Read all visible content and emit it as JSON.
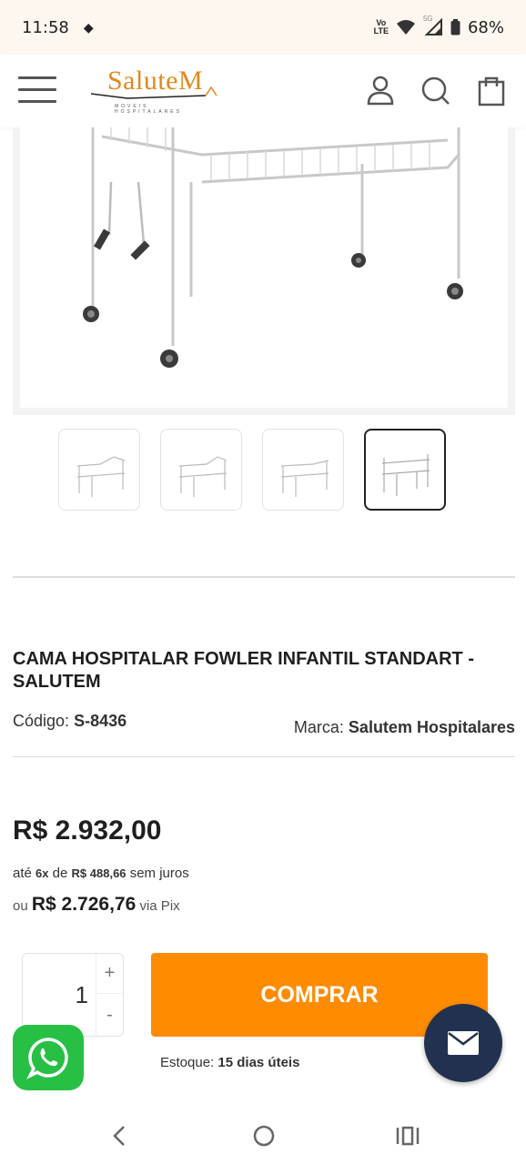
{
  "status_bar": {
    "time": "11:58",
    "network_label_1": "Vo",
    "network_label_2": "LTE",
    "network_5g": "5G",
    "battery": "68%"
  },
  "header": {
    "logo_text": "SaluteM",
    "logo_subtitle": "MOVEIS HOSPITALARES",
    "icons": [
      "menu-icon",
      "user-icon",
      "search-icon",
      "shopping-bag-icon"
    ]
  },
  "gallery": {
    "thumbnail_count": 4,
    "active_index": 3
  },
  "product": {
    "title": "CAMA HOSPITALAR FOWLER INFANTIL STANDART - SALUTEM",
    "code_label": "Código:",
    "code_value": "S-8436",
    "brand_label": "Marca:",
    "brand_value": "Salutem Hospitalares"
  },
  "pricing": {
    "price": "R$ 2.932,00",
    "installment_prefix": "até",
    "installment_count": "6x",
    "installment_of": "de",
    "installment_value": "R$ 488,66",
    "installment_suffix": "sem juros",
    "pix_prefix": "ou",
    "pix_price": "R$ 2.726,76",
    "pix_suffix": "via Pix"
  },
  "purchase": {
    "quantity": "1",
    "plus_label": "+",
    "minus_label": "-",
    "buy_label": "COMPRAR",
    "stock_label": "Estoque:",
    "stock_value": "15 dias úteis"
  },
  "colors": {
    "accent": "#ff8c00",
    "logo": "#e08a1e",
    "whatsapp": "#27c044",
    "mail": "#22314f"
  }
}
